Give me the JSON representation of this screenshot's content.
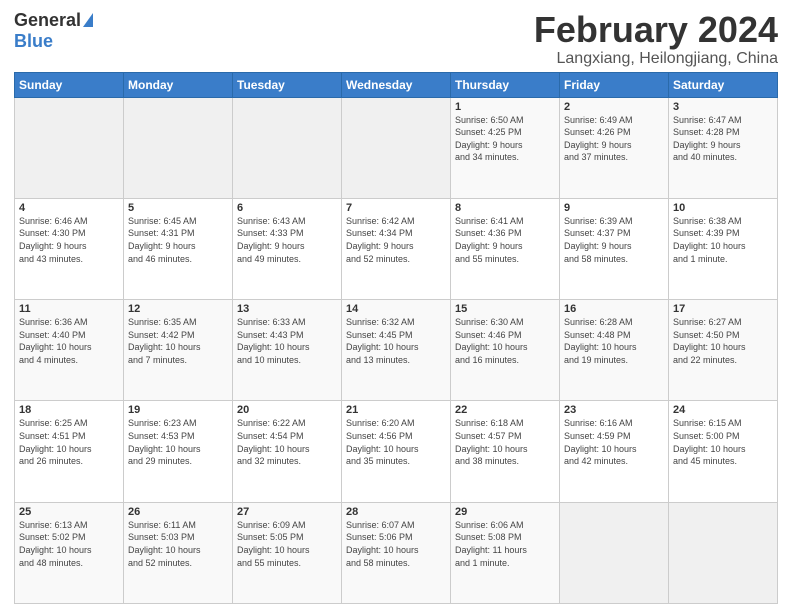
{
  "logo": {
    "general": "General",
    "blue": "Blue"
  },
  "header": {
    "month": "February 2024",
    "location": "Langxiang, Heilongjiang, China"
  },
  "weekdays": [
    "Sunday",
    "Monday",
    "Tuesday",
    "Wednesday",
    "Thursday",
    "Friday",
    "Saturday"
  ],
  "weeks": [
    [
      {
        "day": "",
        "info": ""
      },
      {
        "day": "",
        "info": ""
      },
      {
        "day": "",
        "info": ""
      },
      {
        "day": "",
        "info": ""
      },
      {
        "day": "1",
        "info": "Sunrise: 6:50 AM\nSunset: 4:25 PM\nDaylight: 9 hours\nand 34 minutes."
      },
      {
        "day": "2",
        "info": "Sunrise: 6:49 AM\nSunset: 4:26 PM\nDaylight: 9 hours\nand 37 minutes."
      },
      {
        "day": "3",
        "info": "Sunrise: 6:47 AM\nSunset: 4:28 PM\nDaylight: 9 hours\nand 40 minutes."
      }
    ],
    [
      {
        "day": "4",
        "info": "Sunrise: 6:46 AM\nSunset: 4:30 PM\nDaylight: 9 hours\nand 43 minutes."
      },
      {
        "day": "5",
        "info": "Sunrise: 6:45 AM\nSunset: 4:31 PM\nDaylight: 9 hours\nand 46 minutes."
      },
      {
        "day": "6",
        "info": "Sunrise: 6:43 AM\nSunset: 4:33 PM\nDaylight: 9 hours\nand 49 minutes."
      },
      {
        "day": "7",
        "info": "Sunrise: 6:42 AM\nSunset: 4:34 PM\nDaylight: 9 hours\nand 52 minutes."
      },
      {
        "day": "8",
        "info": "Sunrise: 6:41 AM\nSunset: 4:36 PM\nDaylight: 9 hours\nand 55 minutes."
      },
      {
        "day": "9",
        "info": "Sunrise: 6:39 AM\nSunset: 4:37 PM\nDaylight: 9 hours\nand 58 minutes."
      },
      {
        "day": "10",
        "info": "Sunrise: 6:38 AM\nSunset: 4:39 PM\nDaylight: 10 hours\nand 1 minute."
      }
    ],
    [
      {
        "day": "11",
        "info": "Sunrise: 6:36 AM\nSunset: 4:40 PM\nDaylight: 10 hours\nand 4 minutes."
      },
      {
        "day": "12",
        "info": "Sunrise: 6:35 AM\nSunset: 4:42 PM\nDaylight: 10 hours\nand 7 minutes."
      },
      {
        "day": "13",
        "info": "Sunrise: 6:33 AM\nSunset: 4:43 PM\nDaylight: 10 hours\nand 10 minutes."
      },
      {
        "day": "14",
        "info": "Sunrise: 6:32 AM\nSunset: 4:45 PM\nDaylight: 10 hours\nand 13 minutes."
      },
      {
        "day": "15",
        "info": "Sunrise: 6:30 AM\nSunset: 4:46 PM\nDaylight: 10 hours\nand 16 minutes."
      },
      {
        "day": "16",
        "info": "Sunrise: 6:28 AM\nSunset: 4:48 PM\nDaylight: 10 hours\nand 19 minutes."
      },
      {
        "day": "17",
        "info": "Sunrise: 6:27 AM\nSunset: 4:50 PM\nDaylight: 10 hours\nand 22 minutes."
      }
    ],
    [
      {
        "day": "18",
        "info": "Sunrise: 6:25 AM\nSunset: 4:51 PM\nDaylight: 10 hours\nand 26 minutes."
      },
      {
        "day": "19",
        "info": "Sunrise: 6:23 AM\nSunset: 4:53 PM\nDaylight: 10 hours\nand 29 minutes."
      },
      {
        "day": "20",
        "info": "Sunrise: 6:22 AM\nSunset: 4:54 PM\nDaylight: 10 hours\nand 32 minutes."
      },
      {
        "day": "21",
        "info": "Sunrise: 6:20 AM\nSunset: 4:56 PM\nDaylight: 10 hours\nand 35 minutes."
      },
      {
        "day": "22",
        "info": "Sunrise: 6:18 AM\nSunset: 4:57 PM\nDaylight: 10 hours\nand 38 minutes."
      },
      {
        "day": "23",
        "info": "Sunrise: 6:16 AM\nSunset: 4:59 PM\nDaylight: 10 hours\nand 42 minutes."
      },
      {
        "day": "24",
        "info": "Sunrise: 6:15 AM\nSunset: 5:00 PM\nDaylight: 10 hours\nand 45 minutes."
      }
    ],
    [
      {
        "day": "25",
        "info": "Sunrise: 6:13 AM\nSunset: 5:02 PM\nDaylight: 10 hours\nand 48 minutes."
      },
      {
        "day": "26",
        "info": "Sunrise: 6:11 AM\nSunset: 5:03 PM\nDaylight: 10 hours\nand 52 minutes."
      },
      {
        "day": "27",
        "info": "Sunrise: 6:09 AM\nSunset: 5:05 PM\nDaylight: 10 hours\nand 55 minutes."
      },
      {
        "day": "28",
        "info": "Sunrise: 6:07 AM\nSunset: 5:06 PM\nDaylight: 10 hours\nand 58 minutes."
      },
      {
        "day": "29",
        "info": "Sunrise: 6:06 AM\nSunset: 5:08 PM\nDaylight: 11 hours\nand 1 minute."
      },
      {
        "day": "",
        "info": ""
      },
      {
        "day": "",
        "info": ""
      }
    ]
  ]
}
